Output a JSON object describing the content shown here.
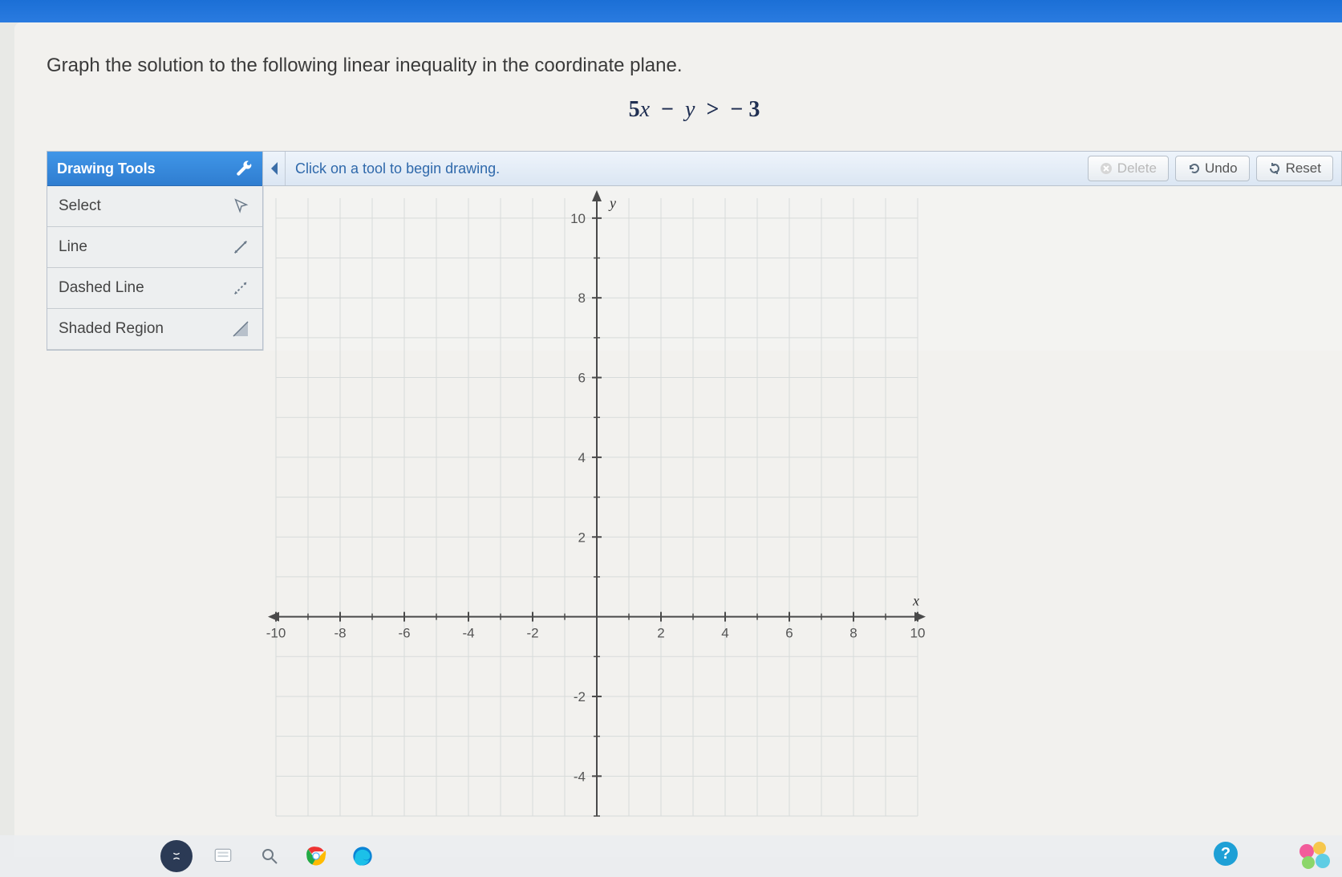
{
  "prompt": "Graph the solution to the following linear inequality in the coordinate plane.",
  "equation": {
    "lhs_coeff": "5",
    "lhs_var1": "x",
    "minus": "−",
    "lhs_var2": "y",
    "op": ">",
    "rhs_neg": "−",
    "rhs_val": "3"
  },
  "toolbox": {
    "header": "Drawing Tools",
    "items": [
      {
        "label": "Select",
        "icon": "cursor"
      },
      {
        "label": "Line",
        "icon": "line"
      },
      {
        "label": "Dashed Line",
        "icon": "dashed"
      },
      {
        "label": "Shaded Region",
        "icon": "shade"
      }
    ]
  },
  "graphbar": {
    "hint": "Click on a tool to begin drawing.",
    "delete": "Delete",
    "undo": "Undo",
    "reset": "Reset"
  },
  "chart_data": {
    "type": "scatter",
    "title": "",
    "xlabel": "x",
    "ylabel": "y",
    "xlim": [
      -10,
      10
    ],
    "ylim": [
      -10,
      10
    ],
    "x_ticks": [
      -10,
      -8,
      -6,
      -4,
      -2,
      2,
      4,
      6,
      8,
      10
    ],
    "y_ticks_visible": [
      -4,
      -2,
      2,
      4,
      6,
      8,
      10
    ],
    "grid": true,
    "series": []
  }
}
